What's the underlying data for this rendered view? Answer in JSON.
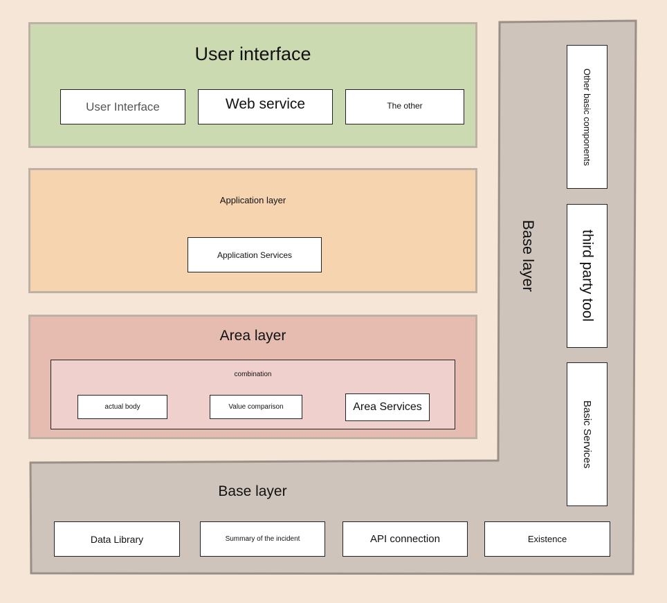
{
  "colors": {
    "background": "#f6e6d8",
    "user_interface": "#ccdab1",
    "application": "#f6d4b0",
    "area": "#e6bcb1",
    "area_inner": "#f0d0cc",
    "base": "#cfc4bb"
  },
  "user_interface": {
    "title": "User interface",
    "items": [
      "User Interface",
      "Web service",
      "The other"
    ]
  },
  "application": {
    "title": "Application layer",
    "items": [
      "Application Services"
    ]
  },
  "area": {
    "title": "Area layer",
    "combination": {
      "title": "combination",
      "items": [
        "actual body",
        "Value comparison",
        "Area Services"
      ]
    }
  },
  "base": {
    "title": "Base layer",
    "vertical_title": "Base layer",
    "items": [
      "Data Library",
      "Summary of the incident",
      "API connection",
      "Existence"
    ],
    "side_items": [
      "Other basic components",
      "third party tool",
      "Basic Services"
    ]
  }
}
